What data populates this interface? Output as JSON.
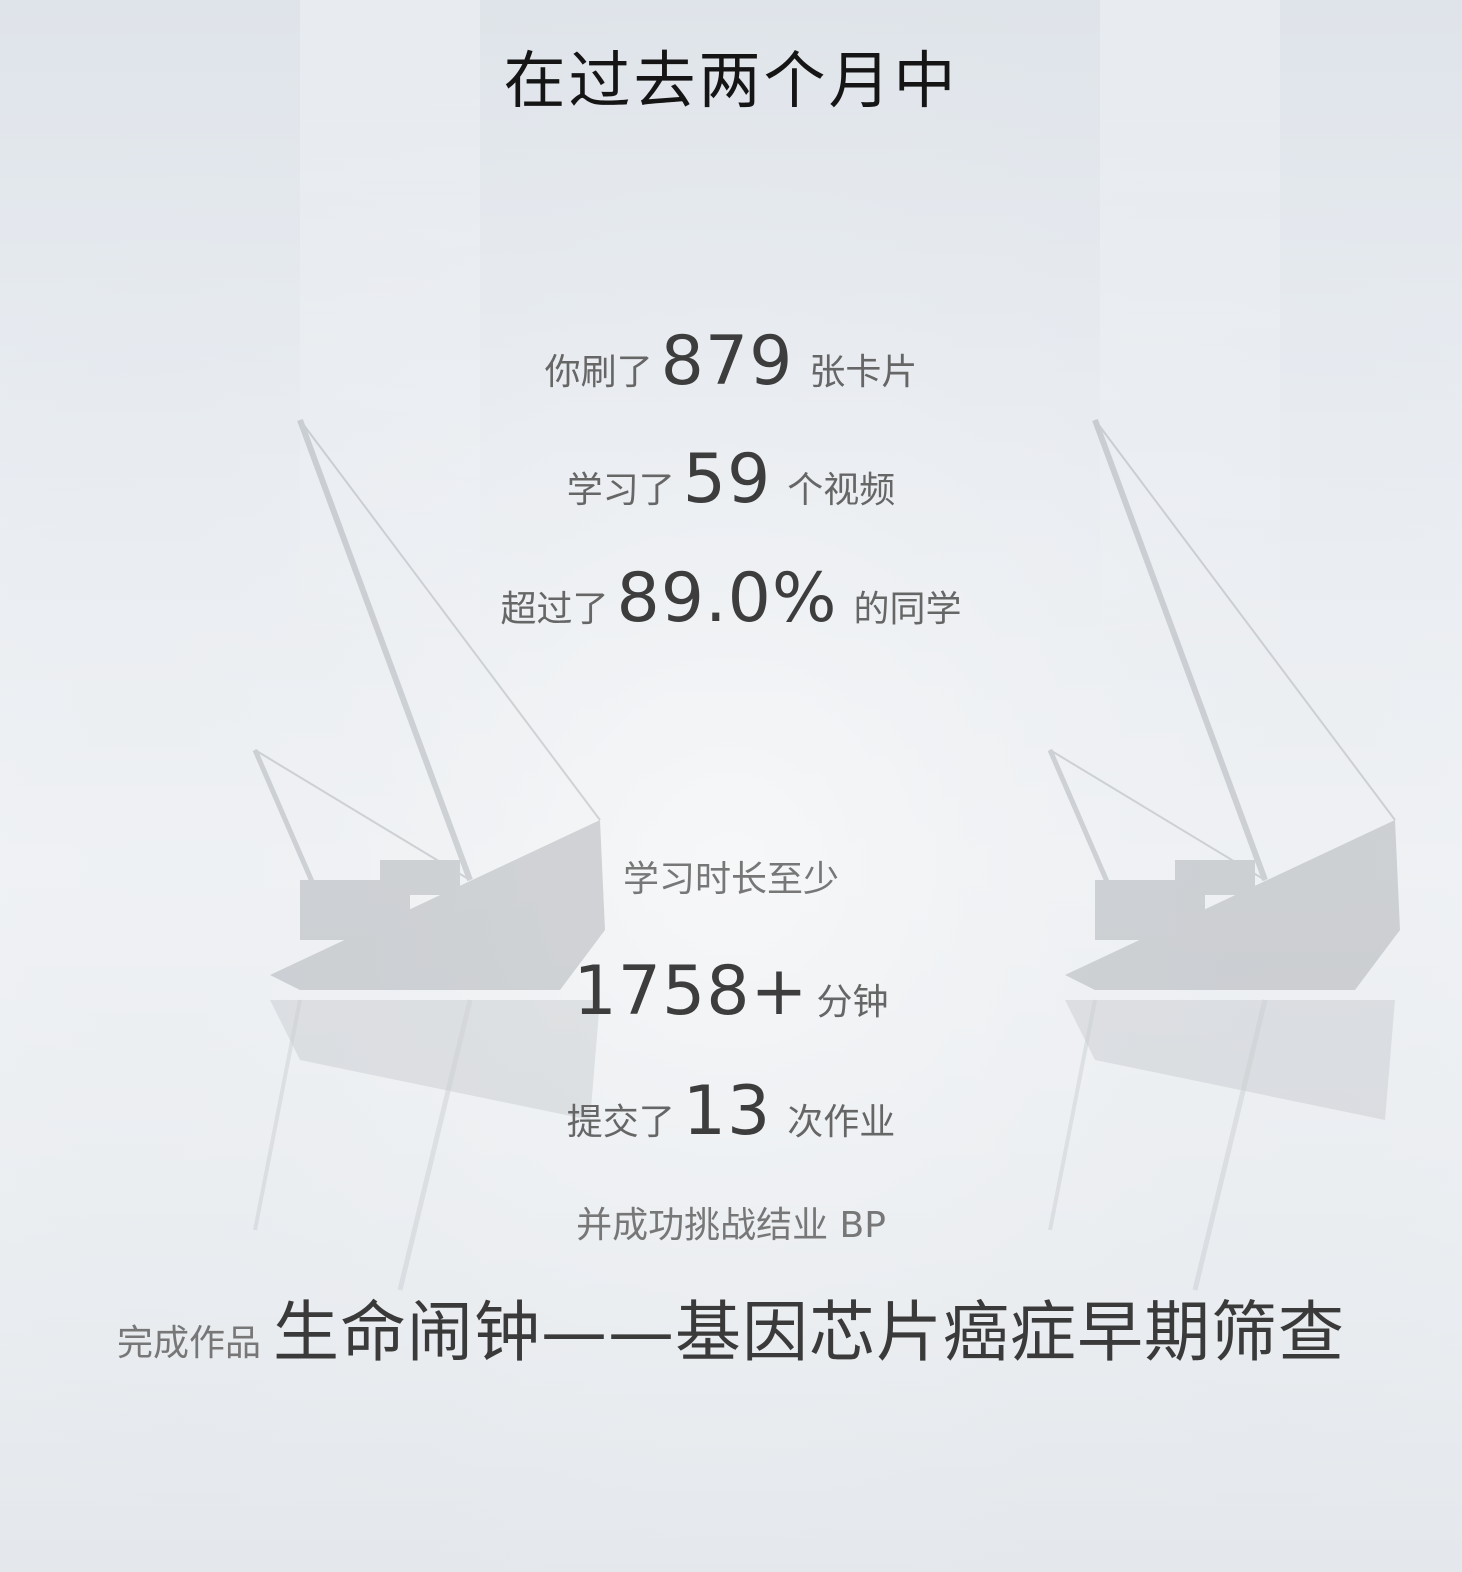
{
  "header": {
    "title": "在过去两个月中"
  },
  "stats": {
    "cards": {
      "prefix": "你刷了",
      "value": "879",
      "suffix": "张卡片"
    },
    "videos": {
      "prefix": "学习了",
      "value": "59",
      "suffix": "个视频"
    },
    "percentile": {
      "prefix": "超过了",
      "value": "89.0%",
      "suffix": "的同学"
    }
  },
  "study_time": {
    "label": "学习时长至少",
    "value": "1758+",
    "unit": "分钟"
  },
  "homework": {
    "prefix": "提交了",
    "value": "13",
    "suffix": "次作业"
  },
  "graduation": {
    "text": "并成功挑战结业 BP"
  },
  "project": {
    "label": "完成作品",
    "title": "生命闹钟——基因芯片癌症早期筛查"
  },
  "theme": {
    "text_dark": "#151515",
    "text_number": "#3d3d3d",
    "text_muted": "#777777"
  }
}
